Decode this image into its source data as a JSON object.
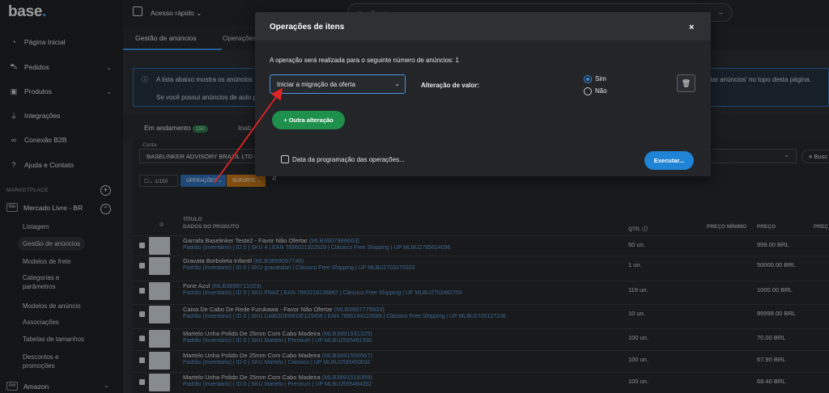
{
  "brand": {
    "logo_text": "base",
    "logo_dot": "."
  },
  "sidebar": {
    "items": [
      {
        "label": "Página Inicial",
        "icon": "gauge-icon"
      },
      {
        "label": "Pedidos",
        "icon": "cart-icon"
      },
      {
        "label": "Produtos",
        "icon": "box-icon"
      },
      {
        "label": "Integrações",
        "icon": "plug-icon"
      },
      {
        "label": "Conexão B2B",
        "icon": "link-icon"
      },
      {
        "label": "Ajuda e Contato",
        "icon": "help-icon"
      }
    ],
    "section_label": "MARKETPLACE",
    "marketplace": {
      "badge": "Me",
      "label": "Mercado Livre - BR"
    },
    "subitems": [
      "Listagem",
      "Gestão de anúncios",
      "Modelos de frete",
      "Categorias e parâmetros",
      "Modelos de anúncio",
      "Associações",
      "Tabelas de tamanhos",
      "Descontos e promoções"
    ],
    "amazon": {
      "badge": "Am",
      "label": "Amazon"
    }
  },
  "topbar": {
    "quick_access": "Acesso rápido",
    "search_placeholder": "Busca..."
  },
  "tabs": {
    "gestao": "Gestão de anúncios",
    "operacoes": "Operações"
  },
  "alert": {
    "line1": "A lista abaixo mostra os anúncios",
    "line1_end": "rtar anúncios' no topo desta página.",
    "line2": "Se você possui anúncios de auto p"
  },
  "cardtabs": {
    "em_andamento": "Em andamento",
    "em_andamento_count": "150",
    "inativos": "Inati"
  },
  "filter": {
    "conta_label": "Conta",
    "conta_value": "BASELINKER ADVISORY BRAZIL LTD BA",
    "busca": "Busc"
  },
  "toolbar": {
    "count": "1/150",
    "operacoes": "OPERAÇÕES",
    "suporte": "SUPORTE"
  },
  "table": {
    "headers": {
      "titulo": "TÍTULO",
      "dados": "DADOS DO PRODUTO",
      "qtd": "QTD.",
      "preco_min": "PREÇO MÍNIMO",
      "preco": "PREÇO",
      "preco2": "PREÇ"
    },
    "rows": [
      {
        "title": "Garrafa Baselinker Teste2 - Favor Não Ofertar",
        "id": "(MLB3907986663)",
        "meta": "Padrão (Inventário) | ID 0 | SKU 4 | EAN 7896021922529 | Clássico Free Shipping | UP MLBU2785614096",
        "qty": "50 un.",
        "price": "999.00 BRL"
      },
      {
        "title": "Gravata Borboleta Infantil",
        "id": "(MLB3899057749)",
        "meta": "Padrão (Inventário) | ID 0 | SKU gravatalari | Clássico Free Shipping | UP MLBU2703270203",
        "qty": "1 un.",
        "price": "50000.00 BRL"
      },
      {
        "title": "Fone Azul",
        "id": "(MLB3898711023)",
        "meta": "Padrão (Inventário) | ID 0 | SKU FNAZ | EAN 7893218136882 | Clássico Free Shipping | UP MLBU2702482753",
        "qty": "119 un.",
        "price": "1000.00 BRL"
      },
      {
        "title": "Caixa De Cabo De Rede Furukawa - Favor Não Ofertar",
        "id": "(MLB3897775833)",
        "meta": "Padrão (Inventário) | ID 0 | SKU CABODEREDE123456 | EAN 7895194222689 | Clássico Free Shipping | UP MLBU2705127236",
        "qty": "10 un.",
        "price": "99999.00 BRL"
      },
      {
        "title": "Martelo Unha Polido De 25mm Com Cabo Madeira",
        "id": "(MLB3891531325)",
        "meta": "Padrão (Inventário) | ID 0 | SKU Martelo | Premium | UP MLBU2595491500",
        "qty": "100 un.",
        "price": "70.00 BRL"
      },
      {
        "title": "Martelo Unha Polido De 25mm Com Cabo Madeira",
        "id": "(MLB3891556567)",
        "meta": "Padrão (Inventário) | ID 0 | SKU Martelo | Clássico | UP MLBU2595493032",
        "qty": "100 un.",
        "price": "67.90 BRL"
      },
      {
        "title": "Martelo Unha Polido De 25mm Com Cabo Madeira",
        "id": "(MLB3891518359)",
        "meta": "Padrão (Inventário) | ID 0 | SKU Martelo | Premium | UP MLBU2595494352",
        "qty": "100 un.",
        "price": "68.40 BRL"
      }
    ]
  },
  "modal": {
    "title": "Operações de itens",
    "close": "×",
    "info": "A operação será realizada para o seguinte número de anúncios: 1",
    "select_value": "Iniciar a migração da oferta",
    "alt_label": "Alteração de valor:",
    "radio_sim": "Sim",
    "radio_nao": "Não",
    "add_button": "Outra alteração",
    "date_label": "Data da programação das operações...",
    "execute": "Executar..."
  },
  "colors": {
    "accent": "#1f84d6",
    "green": "#1f8f4c",
    "orange": "#c8781a",
    "link": "#5f9ddb",
    "arrow": "#e02424"
  }
}
